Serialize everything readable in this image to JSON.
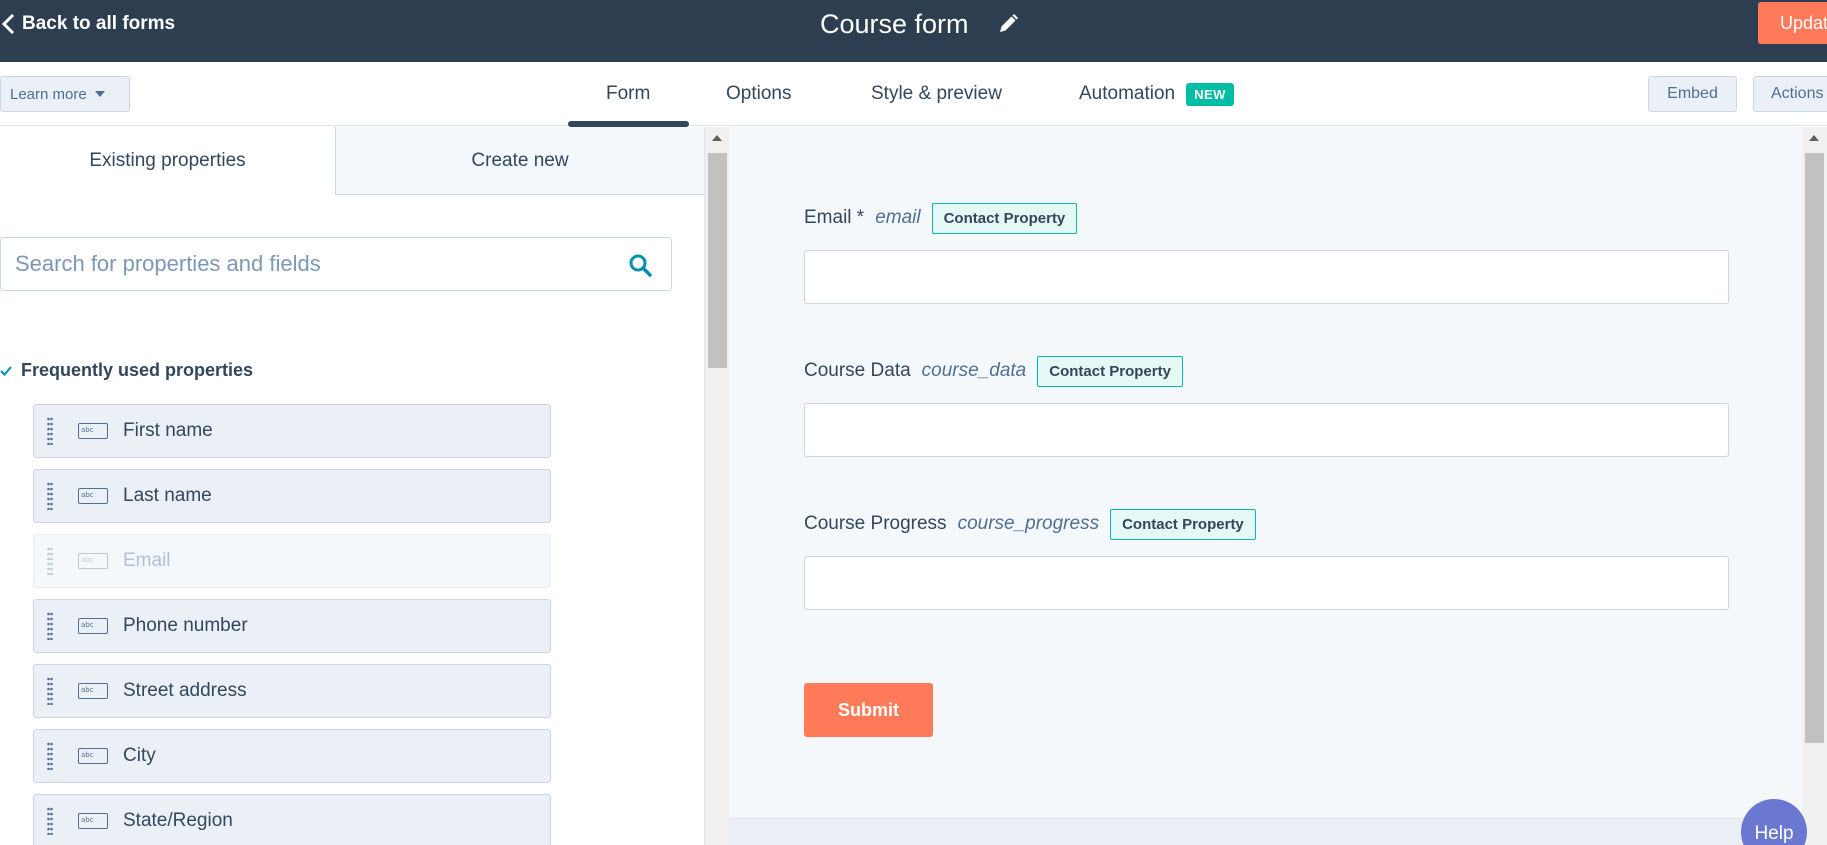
{
  "header": {
    "back_label": "Back to all forms",
    "form_title": "Course form",
    "update_label": "Update"
  },
  "tabs": {
    "learn_more": "Learn more",
    "items": [
      {
        "label": "Form",
        "active": true
      },
      {
        "label": "Options"
      },
      {
        "label": "Style & preview"
      },
      {
        "label": "Automation",
        "badge": "NEW"
      }
    ],
    "embed_label": "Embed",
    "actions_label": "Actions"
  },
  "sidebar": {
    "tabs": [
      "Existing properties",
      "Create new"
    ],
    "search_placeholder": "Search for properties and fields",
    "section_title": "Frequently used properties",
    "icon_text": "abc",
    "items": [
      {
        "label": "First name"
      },
      {
        "label": "Last name"
      },
      {
        "label": "Email",
        "disabled": true
      },
      {
        "label": "Phone number"
      },
      {
        "label": "Street address"
      },
      {
        "label": "City"
      },
      {
        "label": "State/Region"
      }
    ]
  },
  "preview": {
    "fields": [
      {
        "label": "Email *",
        "internal": "email",
        "tag": "Contact Property"
      },
      {
        "label": "Course Data",
        "internal": "course_data",
        "tag": "Contact Property"
      },
      {
        "label": "Course Progress",
        "internal": "course_progress",
        "tag": "Contact Property"
      }
    ],
    "submit_label": "Submit"
  },
  "help_label": "Help",
  "colors": {
    "header_bg": "#2d3e50",
    "accent_orange": "#ff7a59",
    "teal": "#00bda5",
    "help_purple": "#6a78d1"
  }
}
